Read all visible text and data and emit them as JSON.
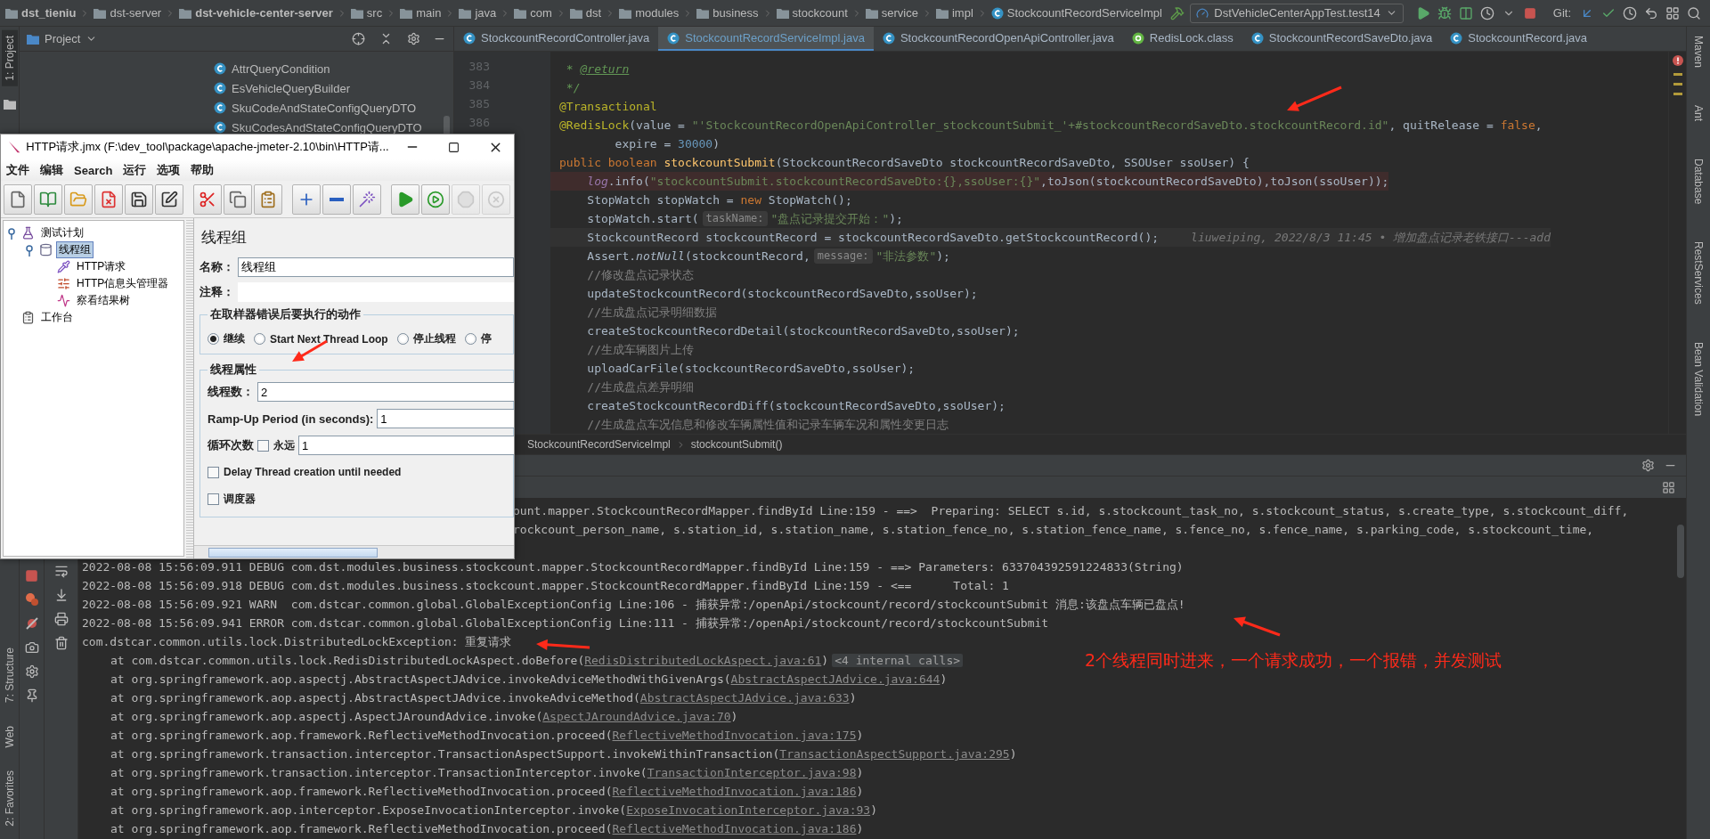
{
  "top_bar": {
    "breadcrumbs": [
      {
        "label": "dst_tieniu",
        "kind": "folder",
        "bold": true
      },
      {
        "label": "dst-server",
        "kind": "folder",
        "bold": false
      },
      {
        "label": "dst-vehicle-center-server",
        "kind": "folder",
        "bold": true
      },
      {
        "label": "src",
        "kind": "folder",
        "bold": false
      },
      {
        "label": "main",
        "kind": "folder",
        "bold": false
      },
      {
        "label": "java",
        "kind": "folder",
        "bold": false
      },
      {
        "label": "com",
        "kind": "folder",
        "bold": false
      },
      {
        "label": "dst",
        "kind": "folder",
        "bold": false
      },
      {
        "label": "modules",
        "kind": "folder",
        "bold": false
      },
      {
        "label": "business",
        "kind": "folder",
        "bold": false
      },
      {
        "label": "stockcount",
        "kind": "folder",
        "bold": false
      },
      {
        "label": "service",
        "kind": "folder",
        "bold": false
      },
      {
        "label": "impl",
        "kind": "folder",
        "bold": false
      },
      {
        "label": "StockcountRecordServiceImpl",
        "kind": "class",
        "bold": false
      }
    ],
    "run_config": "DstVehicleCenterAppTest.test14",
    "vcs_label": "Git:"
  },
  "left_tool_tabs": [
    {
      "label": "1: Project",
      "selected": true
    }
  ],
  "left_bottom_tabs": [
    {
      "label": "7: Structure",
      "selected": false
    },
    {
      "label": "Web",
      "selected": false
    },
    {
      "label": "2: Favorites",
      "selected": false
    }
  ],
  "right_tool_tabs": [
    "Maven",
    "Ant",
    "Database",
    "RestServices",
    "Bean Validation"
  ],
  "project": {
    "title": "Project",
    "items": [
      "AttrQueryCondition",
      "EsVehicleQueryBuilder",
      "SkuCodeAndStateConfigQueryDTO",
      "SkuCodesAndStateConfigQueryDTO"
    ]
  },
  "editor": {
    "tabs": [
      {
        "label": "StockcountRecordController.java",
        "kind": "class",
        "selected": false
      },
      {
        "label": "StockcountRecordServiceImpl.java",
        "kind": "class",
        "selected": true
      },
      {
        "label": "StockcountRecordOpenApiController.java",
        "kind": "class",
        "selected": false
      },
      {
        "label": "RedisLock.class",
        "kind": "annotation",
        "selected": false
      },
      {
        "label": "StockcountRecordSaveDto.java",
        "kind": "class",
        "selected": false
      },
      {
        "label": "StockcountRecord.java",
        "kind": "class",
        "selected": false
      }
    ],
    "lines": [
      {
        "kind": "normal",
        "num": "383",
        "tokens": [
          {
            "kind": "doc",
            "text": " * "
          },
          {
            "kind": "doctag",
            "text": "@return"
          }
        ]
      },
      {
        "kind": "normal",
        "num": "384",
        "tokens": [
          {
            "kind": "doc",
            "text": " */"
          }
        ]
      },
      {
        "kind": "normal",
        "num": "385",
        "tokens": [
          {
            "kind": "ann",
            "text": "@Transactional"
          }
        ]
      },
      {
        "kind": "normal",
        "num": "386",
        "tokens": [
          {
            "kind": "ann",
            "text": "@RedisLock"
          },
          {
            "kind": "plain",
            "text": "(value = "
          },
          {
            "kind": "str",
            "text": "\"'StockcountRecordOpenApiController_stockcountSubmit_'+#stockcountRecordSaveDto.stockcountRecord.id\""
          },
          {
            "kind": "plain",
            "text": ", quitRelease = "
          },
          {
            "kind": "kw",
            "text": "false"
          },
          {
            "kind": "plain",
            "text": ","
          }
        ]
      },
      {
        "kind": "normal",
        "tokens": [
          {
            "kind": "plain",
            "text": "        expire = "
          },
          {
            "kind": "num",
            "text": "30000"
          },
          {
            "kind": "plain",
            "text": ")"
          }
        ]
      },
      {
        "kind": "normal",
        "tokens": [
          {
            "kind": "kw",
            "text": "public boolean "
          },
          {
            "kind": "fn",
            "text": "stockcountSubmit"
          },
          {
            "kind": "plain",
            "text": "(StockcountRecordSaveDto stockcountRecordSaveDto, SSOUser ssoUser) {"
          }
        ]
      },
      {
        "kind": "error",
        "tokens": [
          {
            "kind": "field",
            "text": "    log"
          },
          {
            "kind": "plain",
            "text": ".info("
          },
          {
            "kind": "str",
            "text": "\"stockcountSubmit.stockcountRecordSaveDto:{},ssoUser:{}\""
          },
          {
            "kind": "plain",
            "text": ",toJson(stockcountRecordSaveDto),toJson(ssoUser));"
          }
        ]
      },
      {
        "kind": "normal",
        "tokens": [
          {
            "kind": "plain",
            "text": "    StopWatch stopWatch = "
          },
          {
            "kind": "kw",
            "text": "new "
          },
          {
            "kind": "plain",
            "text": "StopWatch();"
          }
        ]
      },
      {
        "kind": "normal",
        "tokens": [
          {
            "kind": "plain",
            "text": "    stopWatch.start("
          },
          {
            "kind": "hint",
            "text": "taskName:"
          },
          {
            "kind": "str",
            "text": "\"盘点记录提交开始：\""
          },
          {
            "kind": "plain",
            "text": ");"
          }
        ]
      },
      {
        "kind": "current",
        "tokens": [
          {
            "kind": "plain",
            "text": "    StockcountRecord stockcountRecord = stockcountRecordSaveDto.getStockcountRecord();"
          },
          {
            "kind": "blame",
            "text": "liuweiping, 2022/8/3 11:45 • 增加盘点记录老铁接口---add"
          }
        ]
      },
      {
        "kind": "normal",
        "tokens": [
          {
            "kind": "plain",
            "text": "    Assert."
          },
          {
            "kind": "static",
            "text": "notNull"
          },
          {
            "kind": "plain",
            "text": "(stockcountRecord,"
          },
          {
            "kind": "hint",
            "text": "message:"
          },
          {
            "kind": "str",
            "text": "\"非法参数\""
          },
          {
            "kind": "plain",
            "text": ");"
          }
        ]
      },
      {
        "kind": "normal",
        "tokens": [
          {
            "kind": "cmt",
            "text": "    //修改盘点记录状态"
          }
        ]
      },
      {
        "kind": "normal",
        "tokens": [
          {
            "kind": "plain",
            "text": "    updateStockcountRecord(stockcountRecordSaveDto,ssoUser);"
          }
        ]
      },
      {
        "kind": "normal",
        "tokens": [
          {
            "kind": "cmt",
            "text": "    //生成盘点记录明细数据"
          }
        ]
      },
      {
        "kind": "normal",
        "tokens": [
          {
            "kind": "plain",
            "text": "    createStockcountRecordDetail(stockcountRecordSaveDto,ssoUser);"
          }
        ]
      },
      {
        "kind": "normal",
        "tokens": [
          {
            "kind": "cmt",
            "text": "    //生成车辆图片上传"
          }
        ]
      },
      {
        "kind": "normal",
        "tokens": [
          {
            "kind": "plain",
            "text": "    uploadCarFile(stockcountRecordSaveDto,ssoUser);"
          }
        ]
      },
      {
        "kind": "normal",
        "tokens": [
          {
            "kind": "cmt",
            "text": "    //生成盘点差异明细"
          }
        ]
      },
      {
        "kind": "normal",
        "tokens": [
          {
            "kind": "plain",
            "text": "    createStockcountRecordDiff(stockcountRecordSaveDto,ssoUser);"
          }
        ]
      },
      {
        "kind": "normal",
        "tokens": [
          {
            "kind": "cmt",
            "text": "    //生成盘点车况信息和修改车辆属性值和记录车辆车况和属性变更日志"
          }
        ]
      }
    ],
    "breadcrumbs": [
      "StockcountRecordServiceImpl",
      "stockcountSubmit()"
    ]
  },
  "console": {
    "lines": [
      {
        "kind": "clipped",
        "text": "ount.mapper.StockcountRecordMapper.findById Line:159 - ==>  Preparing: SELECT s.id, s.stockcount_task_no, s.stockcount_status, s.create_type, s.stockcount_diff,"
      },
      {
        "kind": "clipped",
        "text": "rockcount_person_name, s.station_id, s.station_name, s.station_fence_no, s.station_fence_name, s.fence_no, s.fence_name, s.parking_code, s.stockcount_time,"
      },
      {
        "kind": "blank"
      },
      {
        "kind": "log",
        "text": "2022-08-08 15:56:09.911 DEBUG com.dst.modules.business.stockcount.mapper.StockcountRecordMapper.findById Line:159 - ==> Parameters: 633704392591224833(String)"
      },
      {
        "kind": "log",
        "text": "2022-08-08 15:56:09.918 DEBUG com.dst.modules.business.stockcount.mapper.StockcountRecordMapper.findById Line:159 - <==      Total: 1"
      },
      {
        "kind": "log",
        "text": "2022-08-08 15:56:09.921 WARN  com.dstcar.common.global.GlobalExceptionConfig Line:106 - 捕获异常:/openApi/stockcount/record/stockcountSubmit 消息:该盘点车辆已盘点!"
      },
      {
        "kind": "log",
        "text": "2022-08-08 15:56:09.941 ERROR com.dstcar.common.global.GlobalExceptionConfig Line:111 - 捕获异常:/openApi/stockcount/record/stockcountSubmit"
      },
      {
        "kind": "log",
        "text": "com.dstcar.common.utils.lock.DistributedLockException: 重复请求"
      },
      {
        "kind": "stack",
        "text": "at com.dstcar.common.utils.lock.RedisDistributedLockAspect.doBefore(",
        "link": "RedisDistributedLockAspect.java:61",
        "close": ")",
        "badge": "<4 internal calls>"
      },
      {
        "kind": "stack",
        "text": "at org.springframework.aop.aspectj.AbstractAspectJAdvice.invokeAdviceMethodWithGivenArgs(",
        "link": "AbstractAspectJAdvice.java:644",
        "close": ")"
      },
      {
        "kind": "stack",
        "text": "at org.springframework.aop.aspectj.AbstractAspectJAdvice.invokeAdviceMethod(",
        "link": "AbstractAspectJAdvice.java:633",
        "close": ")"
      },
      {
        "kind": "stack",
        "text": "at org.springframework.aop.aspectj.AspectJAroundAdvice.invoke(",
        "link": "AspectJAroundAdvice.java:70",
        "close": ")"
      },
      {
        "kind": "stack",
        "text": "at org.springframework.aop.framework.ReflectiveMethodInvocation.proceed(",
        "link": "ReflectiveMethodInvocation.java:175",
        "close": ")"
      },
      {
        "kind": "stack",
        "text": "at org.springframework.transaction.interceptor.TransactionAspectSupport.invokeWithinTransaction(",
        "link": "TransactionAspectSupport.java:295",
        "close": ")"
      },
      {
        "kind": "stack",
        "text": "at org.springframework.transaction.interceptor.TransactionInterceptor.invoke(",
        "link": "TransactionInterceptor.java:98",
        "close": ")"
      },
      {
        "kind": "stack",
        "text": "at org.springframework.aop.framework.ReflectiveMethodInvocation.proceed(",
        "link": "ReflectiveMethodInvocation.java:186",
        "close": ")"
      },
      {
        "kind": "stack",
        "text": "at org.springframework.aop.interceptor.ExposeInvocationInterceptor.invoke(",
        "link": "ExposeInvocationInterceptor.java:93",
        "close": ")"
      },
      {
        "kind": "stack",
        "text": "at org.springframework.aop.framework.ReflectiveMethodInvocation.proceed(",
        "link": "ReflectiveMethodInvocation.java:186",
        "close": ")"
      }
    ]
  },
  "jmeter": {
    "title": "HTTP请求.jmx (F:\\dev_tool\\package\\apache-jmeter-2.10\\bin\\HTTP请...",
    "menu": [
      "文件",
      "编辑",
      "Search",
      "运行",
      "选项",
      "帮助"
    ],
    "toolbar": [
      {
        "disabled": false
      },
      {
        "disabled": false
      },
      {
        "disabled": false
      },
      {
        "disabled": false
      },
      {
        "disabled": false
      },
      {
        "disabled": false
      },
      {
        "disabled": false
      },
      {
        "disabled": false
      },
      {
        "disabled": false
      },
      {
        "disabled": false
      },
      {
        "disabled": false
      },
      {
        "disabled": false
      },
      {
        "disabled": false
      },
      {
        "disabled": false
      },
      {
        "disabled": true
      },
      {
        "disabled": true
      }
    ],
    "tree": [
      {
        "label": "测试计划",
        "kind": "plan",
        "selected": false,
        "expanded": true,
        "children": [
          {
            "label": "线程组",
            "kind": "thread_group",
            "selected": true,
            "expanded": true,
            "children": [
              {
                "label": "HTTP请求",
                "kind": "sampler",
                "selected": false
              },
              {
                "label": "HTTP信息头管理器",
                "kind": "config",
                "selected": false
              },
              {
                "label": "察看结果树",
                "kind": "listener",
                "selected": false
              }
            ]
          }
        ]
      },
      {
        "label": "工作台",
        "kind": "workbench",
        "selected": false
      }
    ],
    "panel": {
      "title": "线程组",
      "name_label": "名称：",
      "name_value": "线程组",
      "comment_label": "注释：",
      "error_group": {
        "legend": "在取样器错误后要执行的动作",
        "options": [
          {
            "label": "继续",
            "selected": true
          },
          {
            "label": "Start Next Thread Loop",
            "selected": false
          },
          {
            "label": "停止线程",
            "selected": false
          },
          {
            "label": "停",
            "selected": false
          }
        ]
      },
      "thread_group": {
        "legend": "线程属性",
        "threads_label": "线程数：",
        "threads_value": "2",
        "rampup_label": "Ramp-Up Period (in seconds):",
        "rampup_value": "1",
        "loop_label": "循环次数",
        "forever": {
          "label": "永远",
          "checked": false
        },
        "loop_value": "1",
        "delay": {
          "label": "Delay Thread creation until needed",
          "checked": false
        },
        "scheduler": {
          "label": "调度器",
          "checked": false
        }
      }
    }
  },
  "annotation": {
    "note": "2个线程同时进来，一个请求成功，一个报错，并发测试"
  }
}
